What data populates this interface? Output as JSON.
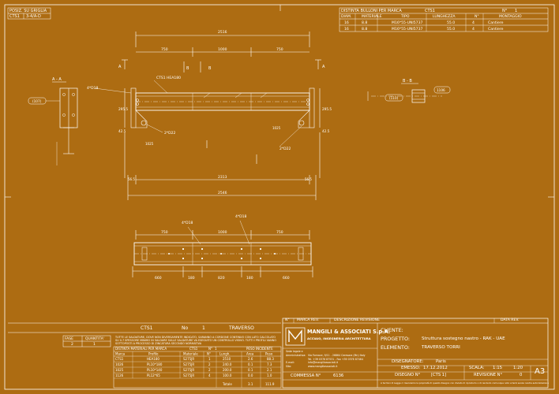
{
  "posiz": {
    "title": "POSIZ. SU GRIGLIA",
    "code": "CTS1",
    "grid": "3-4/A-D"
  },
  "bolts": {
    "title": "DISTINTA BULLONI PER MARCA",
    "mark": "CTS1",
    "count_label": "N°",
    "count": "1",
    "headers": [
      "DIAM.",
      "MATERIALE",
      "TIPO",
      "LUNGHEZZA",
      "N°",
      "MONTAGGIO"
    ],
    "rows": [
      [
        "16",
        "8.8",
        "M16*55-UNI5737",
        "55.0",
        "4",
        "Cantiere"
      ],
      [
        "16",
        "8.8",
        "M16*55-UNI5737",
        "55.0",
        "4",
        "Cantiere"
      ]
    ]
  },
  "drawing": {
    "dims_top": [
      "2516",
      "750",
      "1000",
      "750"
    ],
    "dims_bottom": [
      "2313",
      "2546"
    ],
    "dims_left": [
      "295.5",
      "42.5"
    ],
    "dims_right": [
      "295.5",
      "42.5"
    ],
    "dims_small": [
      "56.5",
      "56.5",
      "40.2",
      "40.2"
    ],
    "labels": [
      "A",
      "A",
      "B",
      "B",
      "CTS1 HEA180",
      "4*D18",
      "2*D22",
      "2*D22",
      "1025",
      "1025",
      "1025"
    ],
    "section_aa": {
      "title": "A - A",
      "d1": "(107)",
      "d2": "4*D18"
    },
    "section_bb": {
      "title": "B - B",
      "d1": "(110)",
      "d2": "1106"
    },
    "plan_dims_top": [
      "750",
      "1000",
      "750"
    ],
    "plan_dims_bottom": [
      "660",
      "180",
      "820",
      "180",
      "660"
    ],
    "plan_labels": [
      "4*D18",
      "4*D18"
    ]
  },
  "assembly": {
    "mark": "CTS1",
    "no_label": "No",
    "no": "1",
    "name": "TRAVERSO"
  },
  "phase": {
    "h1": "FASE",
    "h2": "QUANTITA'",
    "v1": "2",
    "v2": "1"
  },
  "notes": "TUTTE LE SALDATURE, DOVE NON DIVERSAMENTE INDICATO, SARANNO A CORDONE CONTINUO CON LATO CALCOLATO SU 0.7 SPESSORE MINIMO IN SALDARE SULLE SALDATURE VA ESEGUITO UN CONTROLLO VISIVO. TUTTI I PROFILI VANNO SOTTOPOSTI A PROCESSO DI ZINCATURA SECONDO NORMATIVA",
  "materials": {
    "title": "DISTINTA MATERIALI PER MARCA",
    "mark": "CTS1",
    "count_label": "N°",
    "count": "1",
    "weights_label": "PESO INCIDENTE",
    "headers": [
      "Marca",
      "Profilo",
      "Materiale",
      "N°",
      "Lungh.",
      "Area",
      "Peso"
    ],
    "rows": [
      [
        "CTS1",
        "HEA180",
        "S275JR",
        "1",
        "2510",
        "2.6",
        "88.3"
      ],
      [
        "1026",
        "PL10*180",
        "S275JR",
        "2",
        "240.0",
        "0.1",
        "7.3"
      ],
      [
        "1025",
        "PL10*140",
        "S275JR",
        "2",
        "200.0",
        "0.1",
        "2.1"
      ],
      [
        "1126",
        "PL12*65",
        "S275JR",
        "4",
        "100.0",
        "0.0",
        "1.0"
      ]
    ],
    "total_label": "Totale",
    "total_area": "3.1",
    "total_weight": "111.9"
  },
  "revision": {
    "h_no": "N°",
    "h_mark": "MARCA REV.",
    "h_desc": "DESCRIZIONE REVISIONE",
    "h_date": "DATA REV."
  },
  "company": {
    "name": "MANGILI & ASSOCIATI S.p.A.",
    "sub": "ACCIAIO, INGEGNERIA ARCHITETTURA",
    "addr1": "Sede legale e",
    "addr2": "Amministrativa:",
    "addr3": "E-mail:",
    "addr4": "Sito:",
    "street": "Via Fornace, 9/11 - 26864 Ceresara (Mn) Italy",
    "phone": "Tel. +39 0376 87531 - Fax +39 0376 87464",
    "mail": "info@mangiliassociati.it",
    "web": "www.mangiliassociati.it"
  },
  "title_block": {
    "client_label": "CLIENTE:",
    "project_label": "PROGETTO:",
    "project": "Struttura sostegno nastro - RAK - UAE",
    "element_label": "ELEMENTO:",
    "element": "TRAVERSO TORRI",
    "designer_label": "DISEGNATORE:",
    "designer": "Paris",
    "issued_label": "EMESSO:",
    "issued": "17.12.2012",
    "scale_label": "SCALA:",
    "scale1": "1:15",
    "scale2": "1:20",
    "commessa_label": "COMMESSA N°",
    "commessa": "6136",
    "drawing_label": "DISEGNO N°",
    "drawing": "[CTS 1]",
    "revision_label": "REVISIONE N°",
    "revision": "0",
    "format": "A3",
    "footer": "A termini di Legge ci riserviamo la proprietà di questo disegno con divieto di riprodurlo o di renderlo comunque noto a terzi senza nostra autorizzazione"
  }
}
